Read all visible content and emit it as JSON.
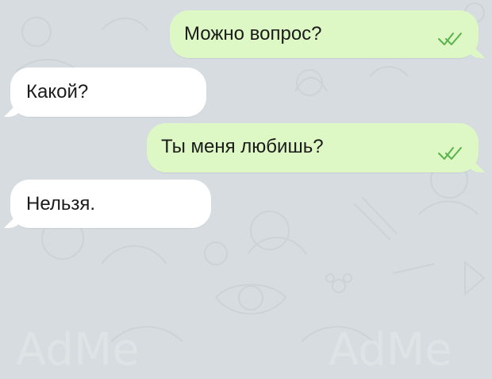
{
  "chat": {
    "messages": [
      {
        "direction": "outgoing",
        "text": "Можно вопрос?",
        "status": "double-check-icon"
      },
      {
        "direction": "incoming",
        "text": "Какой?"
      },
      {
        "direction": "outgoing",
        "text": "Ты меня любишь?",
        "status": "double-check-icon"
      },
      {
        "direction": "incoming",
        "text": "Нельзя."
      }
    ]
  },
  "colors": {
    "background": "#d6dce0",
    "outgoing_bubble": "#def8c5",
    "incoming_bubble": "#ffffff",
    "read_ticks": "#59b34a",
    "text": "#1b1b1b"
  }
}
